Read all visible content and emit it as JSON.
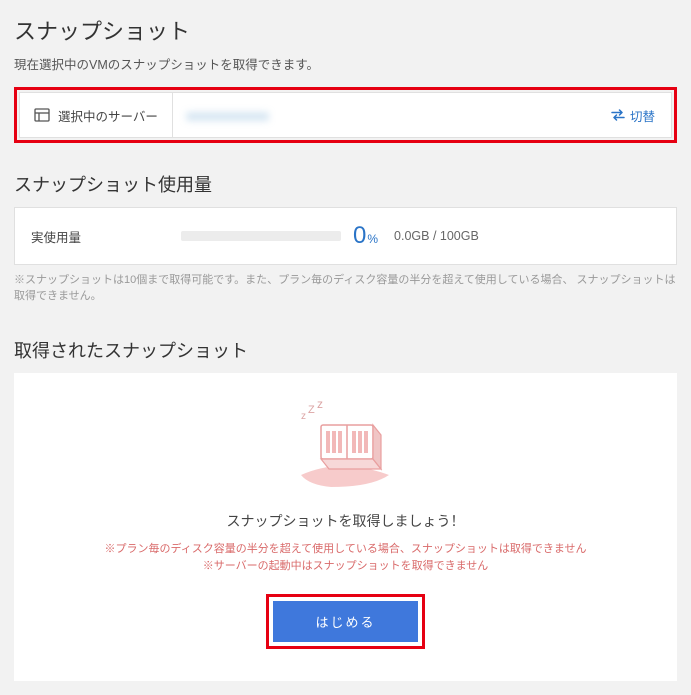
{
  "header": {
    "title": "スナップショット",
    "description": "現在選択中のVMのスナップショットを取得できます。"
  },
  "server": {
    "label": "選択中のサーバー",
    "value": "xxxxxxxxxxx",
    "switch_label": "切替"
  },
  "usage": {
    "section_title": "スナップショット使用量",
    "label": "実使用量",
    "percent": "0",
    "percent_suffix": "%",
    "used": "0.0GB",
    "sep": " / ",
    "total": "100GB",
    "note": "※スナップショットは10個まで取得可能です。また、プラン毎のディスク容量の半分を超えて使用している場合、 スナップショットは取得できません。"
  },
  "snapshots": {
    "section_title": "取得されたスナップショット",
    "empty_message": "スナップショットを取得しましょう！",
    "empty_note1": "※プラン毎のディスク容量の半分を超えて使用している場合、スナップショットは取得できません",
    "empty_note2": "※サーバーの起動中はスナップショットを取得できません",
    "start_button": "はじめる"
  }
}
